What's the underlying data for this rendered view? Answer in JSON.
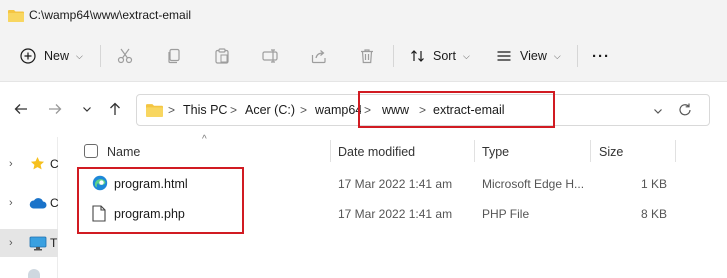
{
  "window": {
    "title": "C:\\wamp64\\www\\extract-email",
    "icon": "folder-icon"
  },
  "toolbar": {
    "new_label": "New",
    "sort_label": "Sort",
    "view_label": "View",
    "more_label": "···",
    "icons": [
      "new-icon",
      "cut-icon",
      "copy-icon",
      "paste-icon",
      "rename-icon",
      "share-icon",
      "delete-icon",
      "sort-icon",
      "view-icon",
      "more-icon"
    ]
  },
  "navigation": {
    "back": "back-arrow-icon",
    "forward": "forward-arrow-icon",
    "recent": "chevron-down-icon",
    "up": "up-arrow-icon"
  },
  "address": {
    "segments": [
      "This PC",
      "Acer (C:)",
      "wamp64",
      "www",
      "extract-email"
    ],
    "separator": ">",
    "refresh_icon": "refresh-icon",
    "dropdown_icon": "chevron-down-icon"
  },
  "sidebar": {
    "items": [
      {
        "label": "C",
        "icon": "star-icon",
        "selected": false
      },
      {
        "label": "C",
        "icon": "cloud-icon",
        "selected": false
      },
      {
        "label": "T",
        "icon": "monitor-icon",
        "selected": true
      }
    ]
  },
  "file_list": {
    "columns": [
      "Name",
      "Date modified",
      "Type",
      "Size"
    ],
    "rows": [
      {
        "name": "program.html",
        "date": "17 Mar 2022 1:41 am",
        "type": "Microsoft Edge H...",
        "size": "1 KB",
        "icon": "edge-icon"
      },
      {
        "name": "program.php",
        "date": "17 Mar 2022 1:41 am",
        "type": "PHP File",
        "size": "8 KB",
        "icon": "file-icon"
      }
    ]
  },
  "colors": {
    "highlight": "#d11b22",
    "folder": "#f4c542",
    "edge": "#1e88d8",
    "background": "#f3f3f3"
  }
}
